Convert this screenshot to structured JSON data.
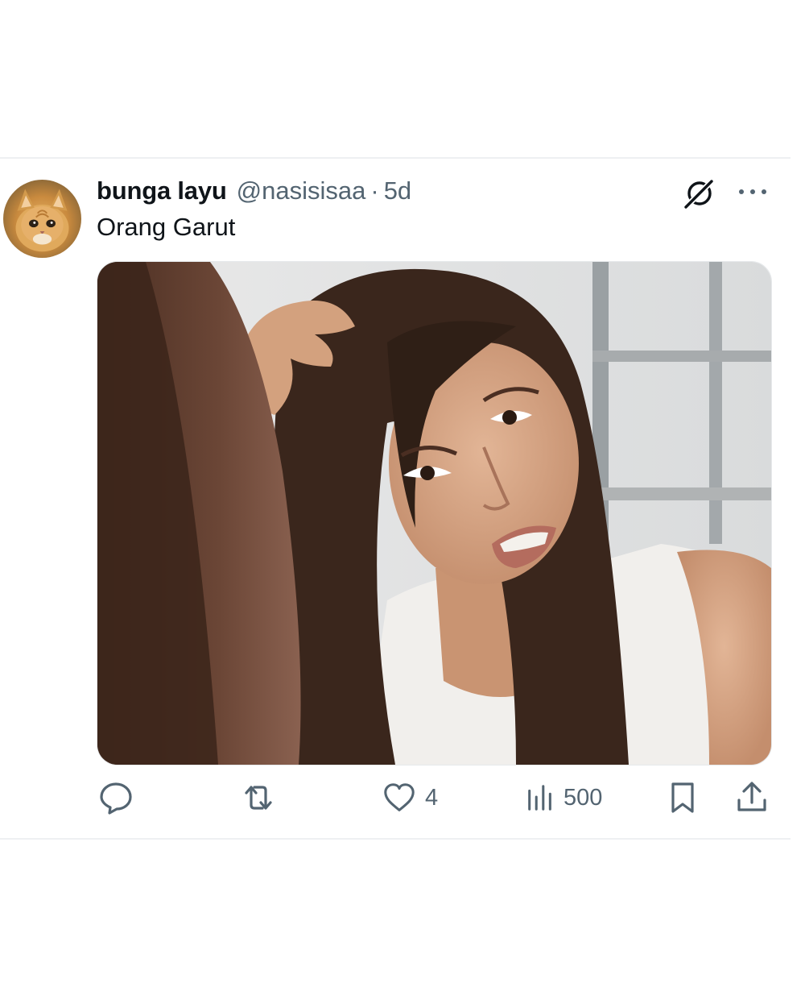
{
  "tweet": {
    "author_name": "bunga layu",
    "handle": "@nasisisaa",
    "separator": "·",
    "time": "5d",
    "text": "Orang Garut",
    "media": {
      "icon": "photo-woman-mirror"
    }
  },
  "actions": {
    "reply": {
      "icon": "reply-icon",
      "count": ""
    },
    "retweet": {
      "icon": "retweet-icon",
      "count": ""
    },
    "like": {
      "icon": "heart-icon",
      "count": "4"
    },
    "views": {
      "icon": "views-icon",
      "count": "500"
    },
    "bookmark": {
      "icon": "bookmark-icon"
    },
    "share": {
      "icon": "share-icon"
    }
  },
  "colors": {
    "text_primary": "#0f1419",
    "text_secondary": "#536471",
    "divider": "#eef0f2"
  }
}
